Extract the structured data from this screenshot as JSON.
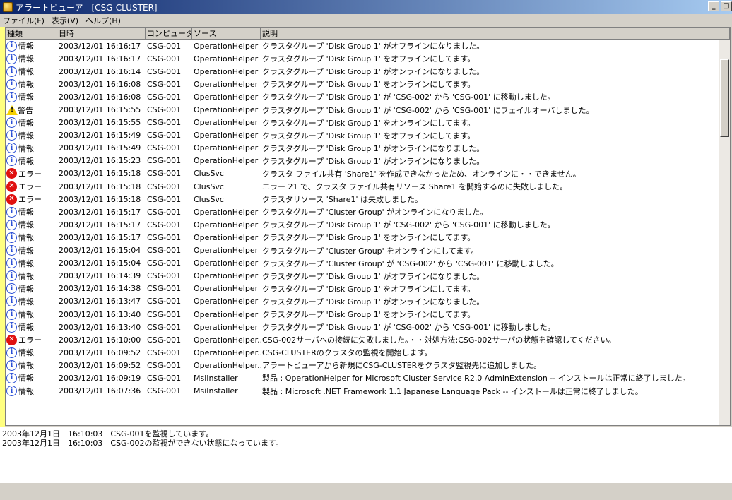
{
  "window": {
    "title": "アラートビューア - [CSG-CLUSTER]",
    "btn_min": "_",
    "btn_max": "□"
  },
  "menu": [
    "ファイル(F)",
    "表示(V)",
    "ヘルプ(H)"
  ],
  "columns": [
    "種類",
    "日時",
    "コンピュータ",
    "ソース",
    "説明"
  ],
  "rows": [
    {
      "icon": "info",
      "type": "情報",
      "date": "2003/12/01 16:16:17",
      "computer": "CSG-001",
      "source": "OperationHelper",
      "desc": "クラスタグループ 'Disk Group 1' がオフラインになりました。"
    },
    {
      "icon": "info",
      "type": "情報",
      "date": "2003/12/01 16:16:17",
      "computer": "CSG-001",
      "source": "OperationHelper",
      "desc": "クラスタグループ 'Disk Group 1' をオフラインにしてます。"
    },
    {
      "icon": "info",
      "type": "情報",
      "date": "2003/12/01 16:16:14",
      "computer": "CSG-001",
      "source": "OperationHelper",
      "desc": "クラスタグループ 'Disk Group 1' がオンラインになりました。"
    },
    {
      "icon": "info",
      "type": "情報",
      "date": "2003/12/01 16:16:08",
      "computer": "CSG-001",
      "source": "OperationHelper",
      "desc": "クラスタグループ 'Disk Group 1' をオンラインにしてます。"
    },
    {
      "icon": "info",
      "type": "情報",
      "date": "2003/12/01 16:16:08",
      "computer": "CSG-001",
      "source": "OperationHelper",
      "desc": "クラスタグループ 'Disk Group 1' が 'CSG-002' から 'CSG-001' に移動しました。"
    },
    {
      "icon": "warn",
      "type": "警告",
      "date": "2003/12/01 16:15:55",
      "computer": "CSG-001",
      "source": "OperationHelper",
      "desc": "クラスタグループ 'Disk Group 1' が 'CSG-002' から 'CSG-001' にフェイルオーバしました。"
    },
    {
      "icon": "info",
      "type": "情報",
      "date": "2003/12/01 16:15:55",
      "computer": "CSG-001",
      "source": "OperationHelper",
      "desc": "クラスタグループ 'Disk Group 1' をオンラインにしてます。"
    },
    {
      "icon": "info",
      "type": "情報",
      "date": "2003/12/01 16:15:49",
      "computer": "CSG-001",
      "source": "OperationHelper",
      "desc": "クラスタグループ 'Disk Group 1' をオフラインにしてます。"
    },
    {
      "icon": "info",
      "type": "情報",
      "date": "2003/12/01 16:15:49",
      "computer": "CSG-001",
      "source": "OperationHelper",
      "desc": "クラスタグループ 'Disk Group 1' がオンラインになりました。"
    },
    {
      "icon": "info",
      "type": "情報",
      "date": "2003/12/01 16:15:23",
      "computer": "CSG-001",
      "source": "OperationHelper",
      "desc": "クラスタグループ 'Disk Group 1' がオンラインになりました。"
    },
    {
      "icon": "err",
      "type": "エラー",
      "date": "2003/12/01 16:15:18",
      "computer": "CSG-001",
      "source": "ClusSvc",
      "desc": "クラスタ ファイル共有 'Share1' を作成できなかったため、オンラインに・・できません。"
    },
    {
      "icon": "err",
      "type": "エラー",
      "date": "2003/12/01 16:15:18",
      "computer": "CSG-001",
      "source": "ClusSvc",
      "desc": "エラー 21 で、クラスタ ファイル共有リソース Share1 を開始するのに失敗しました。"
    },
    {
      "icon": "err",
      "type": "エラー",
      "date": "2003/12/01 16:15:18",
      "computer": "CSG-001",
      "source": "ClusSvc",
      "desc": "クラスタリソース 'Share1' は失敗しました。"
    },
    {
      "icon": "info",
      "type": "情報",
      "date": "2003/12/01 16:15:17",
      "computer": "CSG-001",
      "source": "OperationHelper",
      "desc": "クラスタグループ 'Cluster Group' がオンラインになりました。"
    },
    {
      "icon": "info",
      "type": "情報",
      "date": "2003/12/01 16:15:17",
      "computer": "CSG-001",
      "source": "OperationHelper",
      "desc": "クラスタグループ 'Disk Group 1' が 'CSG-002' から 'CSG-001' に移動しました。"
    },
    {
      "icon": "info",
      "type": "情報",
      "date": "2003/12/01 16:15:17",
      "computer": "CSG-001",
      "source": "OperationHelper",
      "desc": "クラスタグループ 'Disk Group 1' をオンラインにしてます。"
    },
    {
      "icon": "info",
      "type": "情報",
      "date": "2003/12/01 16:15:04",
      "computer": "CSG-001",
      "source": "OperationHelper",
      "desc": "クラスタグループ 'Cluster Group' をオンラインにしてます。"
    },
    {
      "icon": "info",
      "type": "情報",
      "date": "2003/12/01 16:15:04",
      "computer": "CSG-001",
      "source": "OperationHelper",
      "desc": "クラスタグループ 'Cluster Group' が 'CSG-002' から 'CSG-001' に移動しました。"
    },
    {
      "icon": "info",
      "type": "情報",
      "date": "2003/12/01 16:14:39",
      "computer": "CSG-001",
      "source": "OperationHelper",
      "desc": "クラスタグループ 'Disk Group 1' がオフラインになりました。"
    },
    {
      "icon": "info",
      "type": "情報",
      "date": "2003/12/01 16:14:38",
      "computer": "CSG-001",
      "source": "OperationHelper",
      "desc": "クラスタグループ 'Disk Group 1' をオフラインにしてます。"
    },
    {
      "icon": "info",
      "type": "情報",
      "date": "2003/12/01 16:13:47",
      "computer": "CSG-001",
      "source": "OperationHelper",
      "desc": "クラスタグループ 'Disk Group 1' がオンラインになりました。"
    },
    {
      "icon": "info",
      "type": "情報",
      "date": "2003/12/01 16:13:40",
      "computer": "CSG-001",
      "source": "OperationHelper",
      "desc": "クラスタグループ 'Disk Group 1' をオンラインにしてます。"
    },
    {
      "icon": "info",
      "type": "情報",
      "date": "2003/12/01 16:13:40",
      "computer": "CSG-001",
      "source": "OperationHelper",
      "desc": "クラスタグループ 'Disk Group 1' が 'CSG-002' から 'CSG-001' に移動しました。"
    },
    {
      "icon": "err",
      "type": "エラー",
      "date": "2003/12/01 16:10:00",
      "computer": "CSG-001",
      "source": "OperationHelper...",
      "desc": "CSG-002サーバへの接続に失敗しました。・・対処方法:CSG-002サーバの状態を確認してください。"
    },
    {
      "icon": "info",
      "type": "情報",
      "date": "2003/12/01 16:09:52",
      "computer": "CSG-001",
      "source": "OperationHelper...",
      "desc": "CSG-CLUSTERのクラスタの監視を開始します。"
    },
    {
      "icon": "info",
      "type": "情報",
      "date": "2003/12/01 16:09:52",
      "computer": "CSG-001",
      "source": "OperationHelper...",
      "desc": "アラートビューアから新規にCSG-CLUSTERをクラスタ監視先に追加しました。"
    },
    {
      "icon": "info",
      "type": "情報",
      "date": "2003/12/01 16:09:19",
      "computer": "CSG-001",
      "source": "MsiInstaller",
      "desc": "製品 : OperationHelper for Microsoft Cluster Service R2.0 AdminExtension -- インストールは正常に終了しました。"
    },
    {
      "icon": "info",
      "type": "情報",
      "date": "2003/12/01 16:07:36",
      "computer": "CSG-001",
      "source": "MsiInstaller",
      "desc": "製品 : Microsoft .NET Framework 1.1 Japanese Language Pack -- インストールは正常に終了しました。"
    }
  ],
  "detail": [
    "2003年12月1日　16:10:03　CSG-001を監視しています。",
    "2003年12月1日　16:10:03　CSG-002の監視ができない状態になっています。"
  ],
  "colors": {
    "info": "#2a4fd6",
    "warn": "#f5d000",
    "err": "#e01010"
  }
}
